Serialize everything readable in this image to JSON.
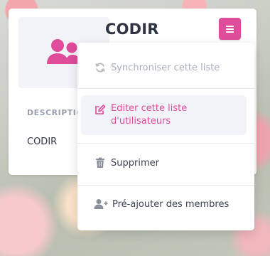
{
  "card": {
    "title": "CODIR",
    "description_label": "DESCRIPTION",
    "description_value": "CODIR"
  },
  "dropdown": {
    "items": [
      {
        "label": "Synchroniser cette liste",
        "icon": "sync-icon",
        "state": "disabled"
      },
      {
        "label_line1": "Editer cette liste",
        "label_line2": "d'utilisateurs",
        "icon": "edit-icon",
        "state": "highlighted"
      },
      {
        "label": "Supprimer",
        "icon": "trash-icon",
        "state": "normal"
      },
      {
        "label": "Pré-ajouter des membres",
        "icon": "user-plus-icon",
        "state": "normal"
      }
    ]
  },
  "colors": {
    "accent": "#de4c9a",
    "title_text": "#2f3542",
    "muted_label": "#9aa1ad",
    "disabled_text": "#a9afb9",
    "highlight_bg": "#f1f3f8"
  }
}
